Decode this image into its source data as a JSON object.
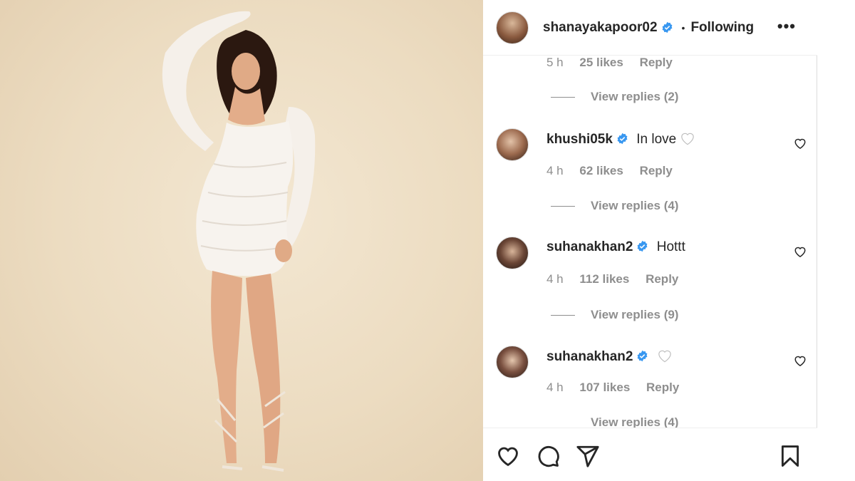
{
  "post": {
    "username": "shanayakapoor02",
    "separator": "•",
    "follow_status": "Following",
    "more_icon": "more-options-icon",
    "verified_color": "#3897f0"
  },
  "top_meta": {
    "time": "5 h",
    "likes": "25 likes",
    "reply": "Reply"
  },
  "top_view_replies": "View replies (2)",
  "comments": [
    {
      "username": "khushi05k",
      "text": "In love",
      "emoji": "white-heart",
      "time": "4 h",
      "likes": "62 likes",
      "reply": "Reply",
      "view_replies": "View replies (4)"
    },
    {
      "username": "suhanakhan2",
      "text": "Hottt",
      "emoji": "",
      "time": "4 h",
      "likes": "112 likes",
      "reply": "Reply",
      "view_replies": "View replies (9)"
    },
    {
      "username": "suhanakhan2",
      "text": "",
      "emoji": "white-heart",
      "time": "4 h",
      "likes": "107 likes",
      "reply": "Reply",
      "view_replies": "View replies (4)"
    }
  ],
  "actions": [
    "like-icon",
    "comment-icon",
    "share-icon",
    "save-icon"
  ]
}
